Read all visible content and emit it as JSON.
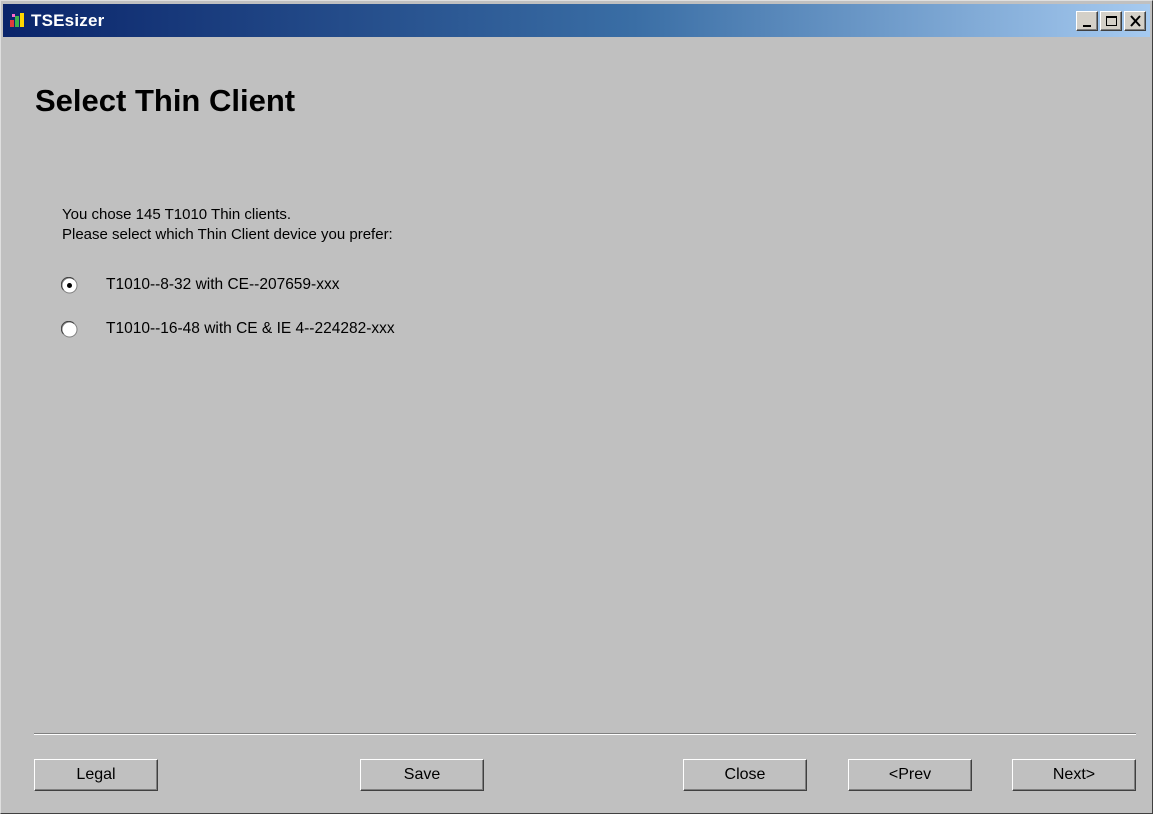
{
  "window": {
    "title": "TSEsizer"
  },
  "page": {
    "title": "Select Thin Client",
    "intro_line1": "You chose 145 T1010 Thin clients.",
    "intro_line2": "Please select which Thin Client device you prefer:"
  },
  "options": [
    {
      "label": "T1010--8-32 with CE--207659-xxx",
      "selected": true
    },
    {
      "label": "T1010--16-48 with CE & IE 4--224282-xxx",
      "selected": false
    }
  ],
  "buttons": {
    "legal": "Legal",
    "save": "Save",
    "close": "Close",
    "prev": "<Prev",
    "next": "Next>"
  }
}
